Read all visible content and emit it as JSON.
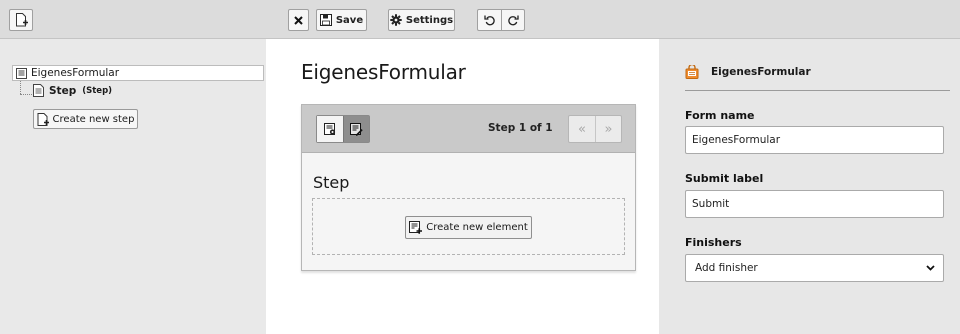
{
  "toolbar": {
    "new_page_icon": "document-add-icon",
    "close_icon": "close-icon",
    "save_label": "Save",
    "settings_label": "Settings",
    "undo_icon": "undo-icon",
    "redo_icon": "redo-icon"
  },
  "tree": {
    "root_label": "EigenesFormular",
    "child_label": "Step",
    "child_type": "(Step)",
    "create_step_label": "Create new step"
  },
  "stage": {
    "form_title": "EigenesFormular",
    "step_counter": "Step 1 of 1",
    "prev_label": "«",
    "next_label": "»",
    "step_title": "Step",
    "create_element_label": "Create new element"
  },
  "inspector": {
    "header_title": "EigenesFormular",
    "form_name_label": "Form name",
    "form_name_value": "EigenesFormular",
    "submit_label_label": "Submit label",
    "submit_label_value": "Submit",
    "finishers_label": "Finishers",
    "finishers_selected": "Add finisher"
  },
  "colors": {
    "toolbar_bg": "#dcdcdc",
    "panel_bg": "#e9e9e9",
    "step_header_bg": "#c9c9c9",
    "active_view_bg": "#8e8e8e",
    "form_icon_orange": "#f08c2e"
  }
}
